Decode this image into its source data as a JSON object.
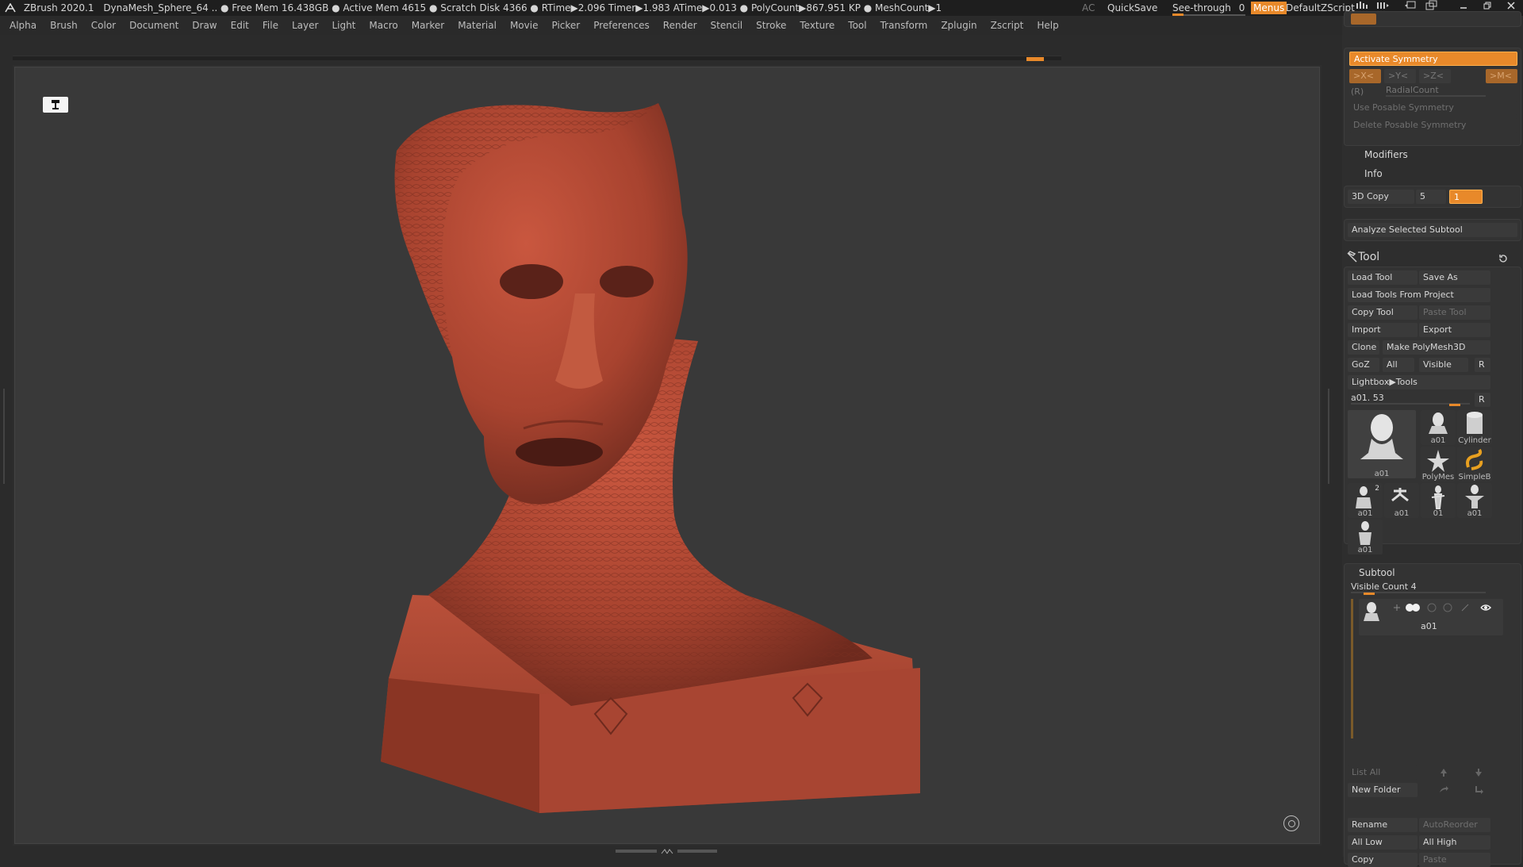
{
  "titlebar": {
    "app": "ZBrush 2020.1",
    "status": "DynaMesh_Sphere_64 .. ● Free Mem 16.438GB ● Active Mem 4615 ● Scratch Disk 4366 ● RTime▶2.096 Timer▶1.983 ATime▶0.013 ● PolyCount▶867.951 KP ● MeshCount▶1",
    "ac": "AC",
    "quicksave": "QuickSave",
    "seethrough_label": "See-through",
    "seethrough_value": "0",
    "menus": "Menus",
    "script": "DefaultZScript"
  },
  "menubar": [
    "Alpha",
    "Brush",
    "Color",
    "Document",
    "Draw",
    "Edit",
    "File",
    "Layer",
    "Light",
    "Macro",
    "Marker",
    "Material",
    "Movie",
    "Picker",
    "Preferences",
    "Render",
    "Stencil",
    "Stroke",
    "Texture",
    "Tool",
    "Transform",
    "Zplugin",
    "Zscript",
    "Help"
  ],
  "symmetry": {
    "activate": "Activate Symmetry",
    "x": ">X<",
    "y": ">Y<",
    "z": ">Z<",
    "m": ">M<",
    "r": "(R)",
    "radial": "RadialCount",
    "use_posable": "Use Posable Symmetry",
    "delete_posable": "Delete Posable Symmetry"
  },
  "modifiers": "Modifiers",
  "info": "Info",
  "copy3d": {
    "label": "3D Copy",
    "value": "5",
    "field": "1"
  },
  "analyze": "Analyze Selected Subtool",
  "tool": {
    "title": "Tool",
    "load_tool": "Load Tool",
    "save_as": "Save As",
    "load_from_project": "Load Tools From Project",
    "copy_tool": "Copy Tool",
    "paste_tool": "Paste Tool",
    "import": "Import",
    "export": "Export",
    "clone": "Clone",
    "make_polymesh": "Make PolyMesh3D",
    "goz": "GoZ",
    "all": "All",
    "visible": "Visible",
    "r": "R",
    "lightbox": "Lightbox▶Tools",
    "current": "a01. 53",
    "thumbs": {
      "main": "a01",
      "t1": "a01",
      "t2": "Cylinder",
      "t3": "PolyMes",
      "t4": "SimpleB",
      "t5": "a01",
      "t5_badge": "2",
      "t6": "a01",
      "t7": "01",
      "t8": "a01",
      "t9": "a01"
    }
  },
  "subtool": {
    "title": "Subtool",
    "visible_count": "Visible Count 4",
    "item": "a01",
    "list_all": "List All",
    "new_folder": "New Folder",
    "rename": "Rename",
    "autoreorder": "AutoReorder",
    "all_low": "All Low",
    "all_high": "All High",
    "copy": "Copy",
    "paste": "Paste"
  },
  "colors": {
    "accent": "#e8892a",
    "sculpt": "#a8432f",
    "bg": "#393939"
  }
}
